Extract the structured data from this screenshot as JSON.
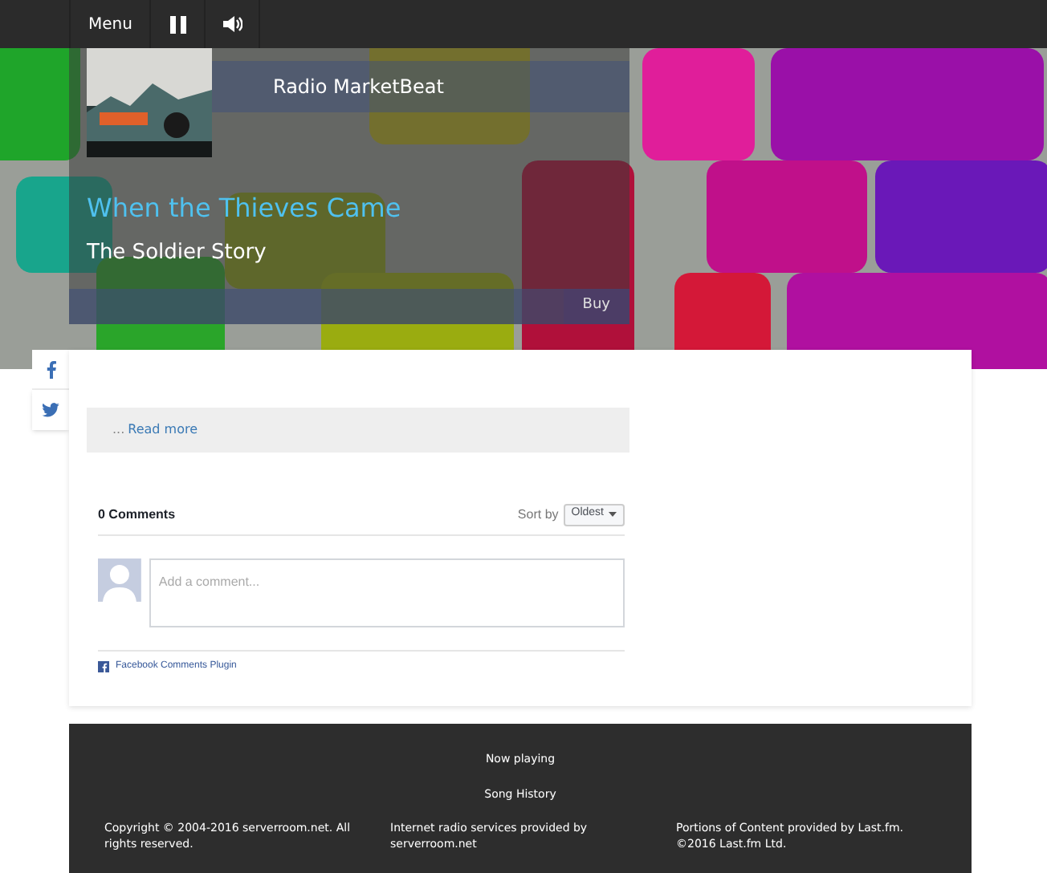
{
  "nav": {
    "menu_label": "Menu"
  },
  "player": {
    "station": "Radio MarketBeat",
    "song": "When the Thieves Came",
    "artist": "The Soldier Story",
    "buy_label": "Buy"
  },
  "read_more": {
    "ellipsis": "...",
    "link": "Read more"
  },
  "comments": {
    "count_label": "0 Comments",
    "sort_label": "Sort by",
    "sort_value": "Oldest",
    "placeholder": "Add a comment...",
    "plugin_label": "Facebook Comments Plugin"
  },
  "footer": {
    "links": [
      "Now playing",
      "Song History"
    ],
    "columns": [
      "Copyright © 2004-2016 serverroom.net. All rights reserved.",
      "Internet radio services provided by serverroom.net",
      "Portions of Content provided by Last.fm. ©2016 Last.fm Ltd."
    ]
  }
}
